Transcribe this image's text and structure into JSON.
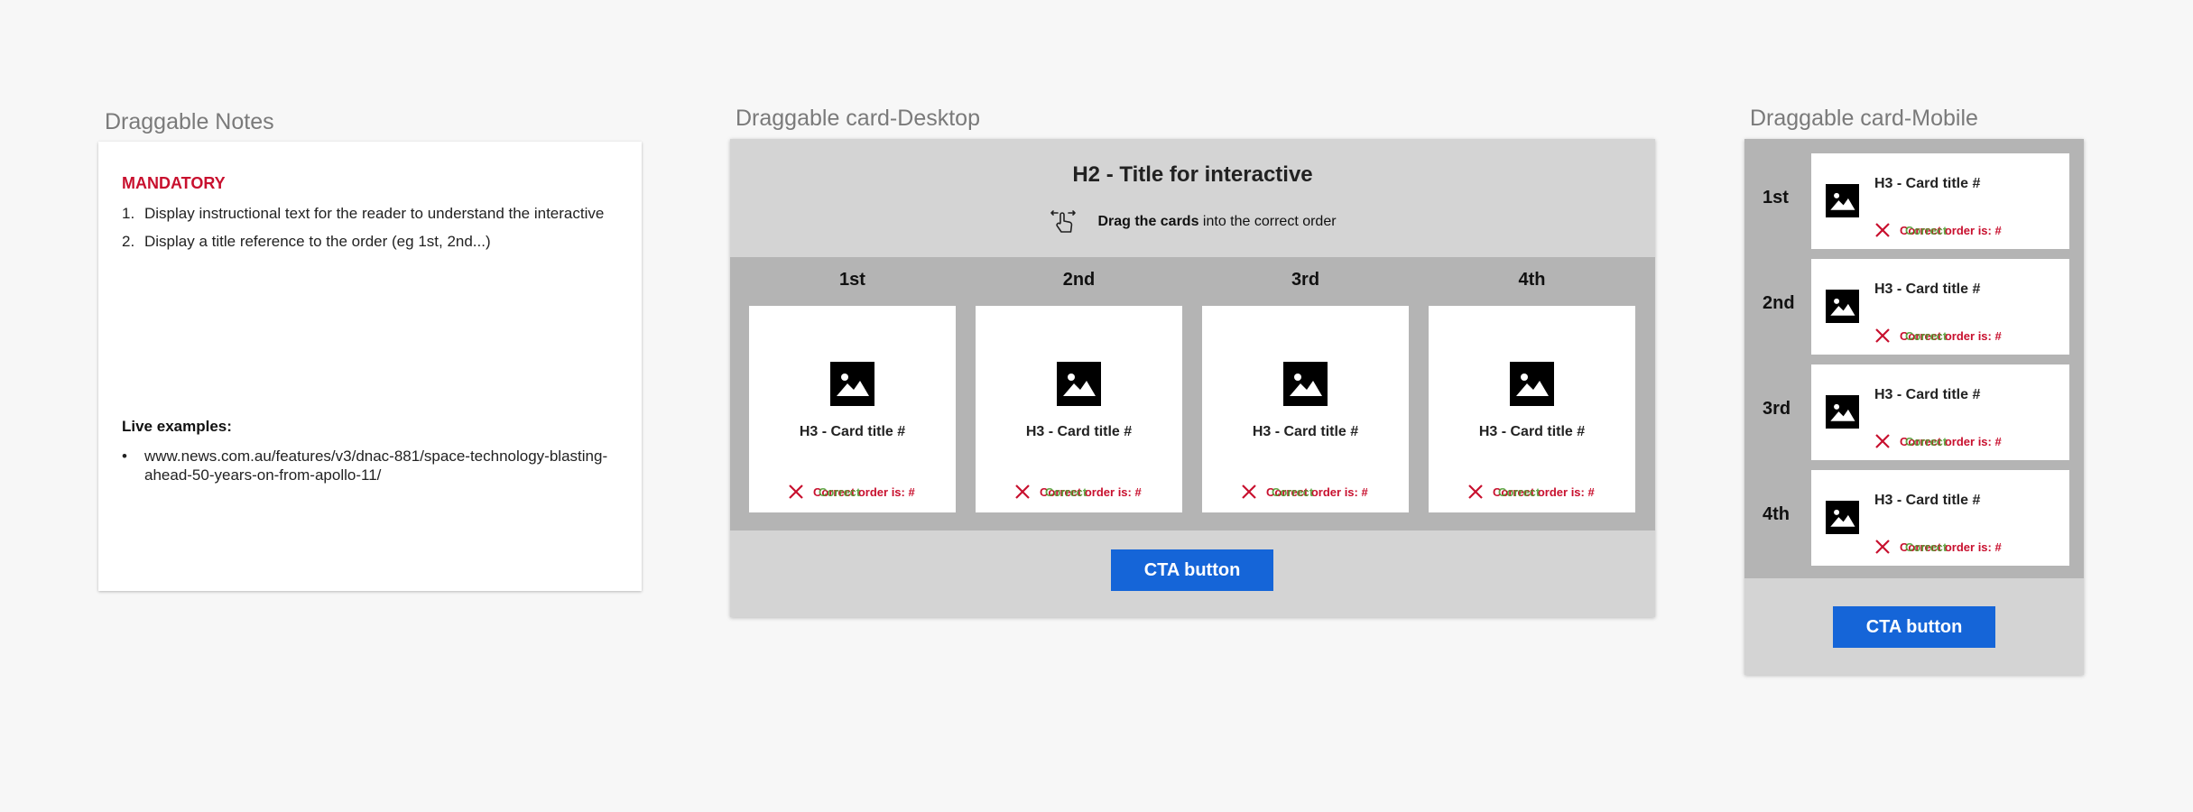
{
  "labels": {
    "notes": "Draggable Notes",
    "desktop": "Draggable card-Desktop",
    "mobile": "Draggable card-Mobile"
  },
  "notes": {
    "mandatory": "MANDATORY",
    "items": [
      {
        "num": "1.",
        "text": "Display instructional text for the reader to understand the interactive"
      },
      {
        "num": "2.",
        "text": "Display a title reference  to the order (eg 1st, 2nd...)"
      }
    ],
    "live_heading": "Live examples:",
    "links": [
      {
        "bullet": "•",
        "text": "www.news.com.au/features/v3/dnac-881/space-technology-blasting-ahead-50-years-on-from-apollo-11/"
      }
    ]
  },
  "interactive": {
    "title": "H2 - Title for interactive",
    "instruction_bold": "Drag the cards",
    "instruction_rest": " into the correct order",
    "orders": [
      "1st",
      "2nd",
      "3rd",
      "4th"
    ],
    "card_title": "H3 - Card title #",
    "feedback_wrong": "Correct order is: #",
    "feedback_right": "Correct",
    "cta": "CTA button"
  },
  "icons": {
    "instruction": "drag-hand-icon",
    "card": "image-placeholder-icon",
    "feedback": "close-x-icon"
  },
  "colors": {
    "accent": "#c8102e",
    "cta": "#1565d8",
    "correct": "#4a9a2a",
    "frame_bg": "#d4d4d4",
    "grid_bg": "#b4b4b4"
  }
}
